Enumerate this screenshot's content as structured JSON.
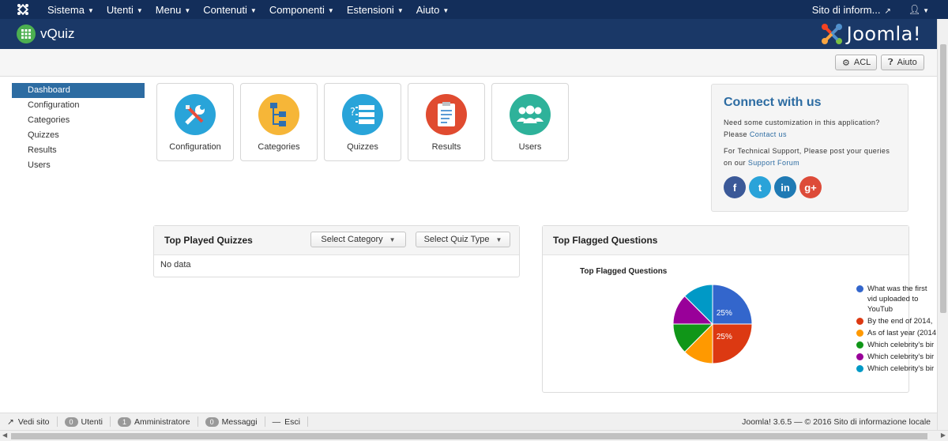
{
  "topnav": {
    "menu": [
      {
        "label": "Sistema"
      },
      {
        "label": "Utenti"
      },
      {
        "label": "Menu"
      },
      {
        "label": "Contenuti"
      },
      {
        "label": "Componenti"
      },
      {
        "label": "Estensioni"
      },
      {
        "label": "Aiuto"
      }
    ],
    "site_link": "Sito di inform..."
  },
  "header": {
    "app_title": "vQuiz",
    "brand": "Joomla!"
  },
  "toolbar": {
    "acl_label": "ACL",
    "help_label": "Aiuto"
  },
  "sidebar": {
    "items": [
      {
        "label": "Dashboard",
        "active": true
      },
      {
        "label": "Configuration"
      },
      {
        "label": "Categories"
      },
      {
        "label": "Quizzes"
      },
      {
        "label": "Results"
      },
      {
        "label": "Users"
      }
    ]
  },
  "tiles": [
    {
      "label": "Configuration",
      "color": "#29a4d9",
      "icon": "wrench-screwdriver-icon"
    },
    {
      "label": "Categories",
      "color": "#f6b638",
      "icon": "hierarchy-icon"
    },
    {
      "label": "Quizzes",
      "color": "#29a4d9",
      "icon": "question-list-icon"
    },
    {
      "label": "Results",
      "color": "#e04b30",
      "icon": "clipboard-chart-icon"
    },
    {
      "label": "Users",
      "color": "#2eb29a",
      "icon": "users-group-icon"
    }
  ],
  "connect": {
    "title": "Connect with us",
    "custom_text": "Need some customization in this application? Please",
    "contact_link": "Contact us",
    "support_text": "For Technical Support, Please post your queries on our",
    "forum_link": "Support Forum",
    "social": [
      {
        "name": "facebook-icon",
        "glyph": "f",
        "color": "#3b5998"
      },
      {
        "name": "twitter-icon",
        "glyph": "t",
        "color": "#2aa3d9"
      },
      {
        "name": "linkedin-icon",
        "glyph": "in",
        "color": "#1f7ab4"
      },
      {
        "name": "google-plus-icon",
        "glyph": "g+",
        "color": "#dd4b39"
      }
    ]
  },
  "top_played": {
    "title": "Top Played Quizzes",
    "select_category": "Select Category",
    "select_quiz_type": "Select Quiz Type",
    "empty_text": "No data"
  },
  "top_flagged": {
    "title": "Top Flagged Questions"
  },
  "chart_data": {
    "type": "pie",
    "title": "Top Flagged Questions",
    "slices": [
      {
        "label": "What was the first vid uploaded to YouTub",
        "value": 25,
        "color": "#3366cc",
        "data_label": "25%"
      },
      {
        "label": "By the end of 2014,",
        "value": 25,
        "color": "#dc3912",
        "data_label": "25%"
      },
      {
        "label": "As of last year (2014",
        "value": 12.5,
        "color": "#ff9900"
      },
      {
        "label": "Which celebrity's bir",
        "value": 12.5,
        "color": "#109618"
      },
      {
        "label": "Which celebrity's bir",
        "value": 12.5,
        "color": "#990099"
      },
      {
        "label": "Which celebrity's bir",
        "value": 12.5,
        "color": "#0099c6"
      }
    ],
    "legend": "right"
  },
  "statusbar": {
    "view_site": "Vedi sito",
    "users_count": "0",
    "users_label": "Utenti",
    "admin_count": "1",
    "admin_label": "Amministratore",
    "messages_count": "0",
    "messages_label": "Messaggi",
    "logout": "Esci",
    "copyright": "Joomla! 3.6.5 — © 2016 Sito di informazione locale"
  }
}
